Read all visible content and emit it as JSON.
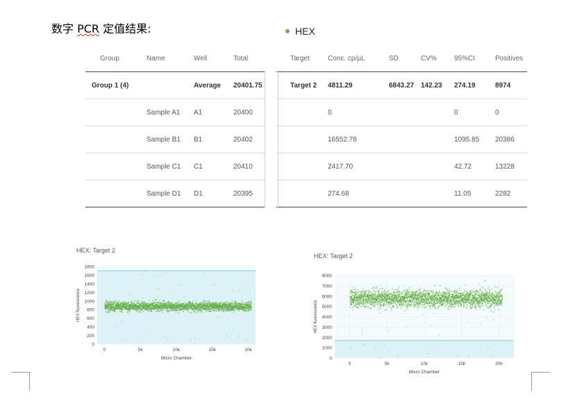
{
  "heading": {
    "prefix": "数字 ",
    "pcr": "PCR",
    "suffix": " 定值结果:"
  },
  "legend": {
    "label": "HEX",
    "color": "#6ab04c"
  },
  "left_table": {
    "headers": [
      "Group",
      "Name",
      "Well",
      "Total"
    ],
    "rows": [
      [
        "Group 1 (4)",
        "",
        "Average",
        "20401.75"
      ],
      [
        "",
        "Sample A1",
        "A1",
        "20400"
      ],
      [
        "",
        "Sample B1",
        "B1",
        "20402"
      ],
      [
        "",
        "Sample C1",
        "C1",
        "20410"
      ],
      [
        "",
        "Sample D1",
        "D1",
        "20395"
      ]
    ]
  },
  "right_table": {
    "headers": [
      "Target",
      "Conc. cp/µL",
      "SD",
      "CV%",
      "95%CI",
      "Positives"
    ],
    "rows": [
      [
        "Target 2",
        "4811.29",
        "6843.27",
        "142.23",
        "274.19",
        "8974"
      ],
      [
        "",
        "0",
        "",
        "",
        "0",
        "0"
      ],
      [
        "",
        "16552.78",
        "",
        "",
        "1095.85",
        "20386"
      ],
      [
        "",
        "2417.70",
        "",
        "",
        "42.72",
        "13228"
      ],
      [
        "",
        "274.68",
        "",
        "",
        "11.05",
        "2282"
      ]
    ]
  },
  "chart_data": [
    {
      "type": "scatter",
      "title": "HEX: Target 2",
      "xlabel": "Micro Chamber",
      "ylabel": "HEX fluorescence",
      "xlim": [
        -1000,
        21000
      ],
      "ylim": [
        0,
        1800
      ],
      "xticks": [
        "0",
        "5k",
        "10k",
        "15k",
        "20k"
      ],
      "xtick_values": [
        0,
        5000,
        10000,
        15000,
        20000
      ],
      "yticks": [
        "0",
        "200",
        "400",
        "600",
        "800",
        "1000",
        "1200",
        "1400",
        "1600",
        "1800"
      ],
      "ytick_values": [
        0,
        200,
        400,
        600,
        800,
        1000,
        1200,
        1400,
        1600,
        1800
      ],
      "series": [
        {
          "n_points": 20400,
          "center": 880,
          "spread_low": 720,
          "spread_high": 1050,
          "color": "#6ab04c"
        }
      ],
      "threshold": 1700,
      "grid": true
    },
    {
      "type": "scatter",
      "title": "HEX: Target 2",
      "xlabel": "Micro Chamber",
      "ylabel": "HEX fluorescence",
      "xlim": [
        -2000,
        22000
      ],
      "ylim": [
        0,
        8000
      ],
      "xticks": [
        "0",
        "5k",
        "10k",
        "15k",
        "20k"
      ],
      "xtick_values": [
        0,
        5000,
        10000,
        15000,
        20000
      ],
      "yticks": [
        "0",
        "1000",
        "2000",
        "3000",
        "4000",
        "5000",
        "6000",
        "7000",
        "8000"
      ],
      "ytick_values": [
        0,
        1000,
        2000,
        3000,
        4000,
        5000,
        6000,
        7000,
        8000
      ],
      "series": [
        {
          "n_points": 20386,
          "center": 5800,
          "spread_low": 4500,
          "spread_high": 7100,
          "color": "#6ab04c"
        }
      ],
      "threshold": 1700,
      "grid": true
    }
  ]
}
